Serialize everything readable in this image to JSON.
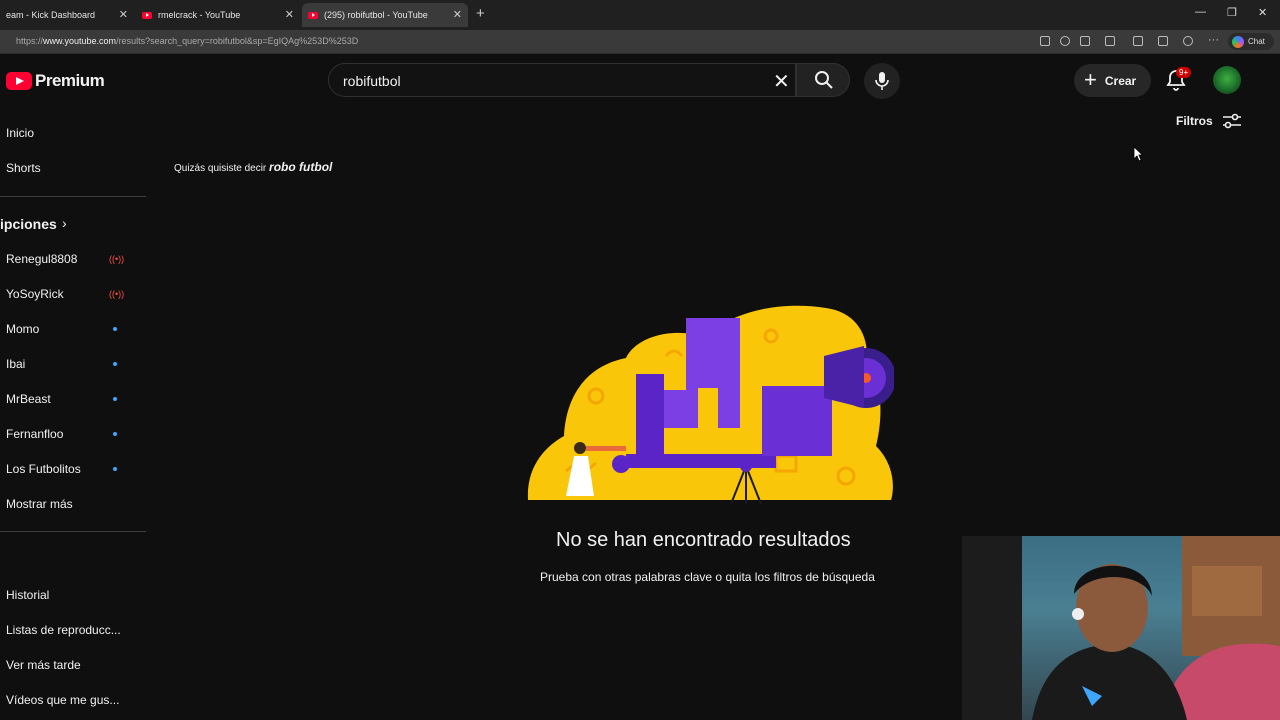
{
  "browser": {
    "tabs": [
      {
        "title": "eam - Kick Dashboard"
      },
      {
        "title": "rmelcrack - YouTube"
      },
      {
        "title": "(295) robifutbol - YouTube"
      }
    ],
    "url_prefix": "https://",
    "url_host": "www.youtube.com",
    "url_path": "/results?search_query=robifutbol&sp=EgIQAg%253D%253D",
    "chat_label": "Chat"
  },
  "header": {
    "logo_text": "Premium",
    "search_value": "robifutbol",
    "create_label": "Crear",
    "notification_badge": "9+",
    "filters_label": "Filtros"
  },
  "sidebar": {
    "main": [
      {
        "label": "Inicio"
      },
      {
        "label": "Shorts"
      }
    ],
    "subscriptions_title": "ipciones",
    "subscriptions": [
      {
        "label": "Renegul8808",
        "status": "live"
      },
      {
        "label": "YoSoyRick",
        "status": "live"
      },
      {
        "label": "Momo",
        "status": "new"
      },
      {
        "label": "Ibai",
        "status": "new"
      },
      {
        "label": "MrBeast",
        "status": "new"
      },
      {
        "label": "Fernanfloo",
        "status": "new"
      },
      {
        "label": "Los Futbolitos",
        "status": "new"
      }
    ],
    "show_more": "Mostrar más",
    "library": [
      {
        "label": "Historial"
      },
      {
        "label": "Listas de reproducc..."
      },
      {
        "label": "Ver más tarde"
      },
      {
        "label": "Vídeos que me gus..."
      }
    ]
  },
  "results": {
    "did_you_mean_prefix": "Quizás quisiste decir",
    "did_you_mean_query": "robo futbol",
    "empty_title": "No se han encontrado resultados",
    "empty_subtitle": "Prueba con otras palabras clave o quita los filtros de búsqueda"
  },
  "colors": {
    "background": "#0f0f0f",
    "brand_red": "#ff0033",
    "live_red": "#ff4e45",
    "new_dot_blue": "#3ea6ff",
    "illustration_yellow": "#f9c60a",
    "illustration_purple": "#6b2fd6"
  }
}
